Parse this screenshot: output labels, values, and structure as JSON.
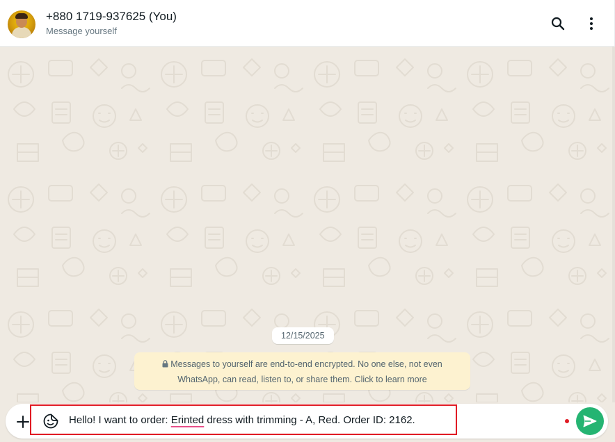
{
  "header": {
    "contact_name": "+880 1719-937625 (You)",
    "contact_subtitle": "Message yourself",
    "icons": [
      "avatar",
      "search-icon",
      "kebab-menu-icon"
    ]
  },
  "chat": {
    "date_chip": "12/15/2025",
    "encryption_notice_line1": "Messages to yourself are end-to-end encrypted. No one else, not even",
    "encryption_notice_line2": "WhatsApp, can read, listen to, or share them. Click to learn more"
  },
  "composer": {
    "text_before": "Hello! I want to order: ",
    "text_misspelled": "Erinted",
    "text_after": " dress with trimming - A, Red. Order ID: 2162.",
    "icons": [
      "plus-icon",
      "sticker-icon",
      "send-icon"
    ]
  },
  "colors": {
    "send_button": "#25b472",
    "notice_background": "#fdf2d0",
    "chat_background": "#efeae2",
    "highlight_border": "#e01b24"
  }
}
